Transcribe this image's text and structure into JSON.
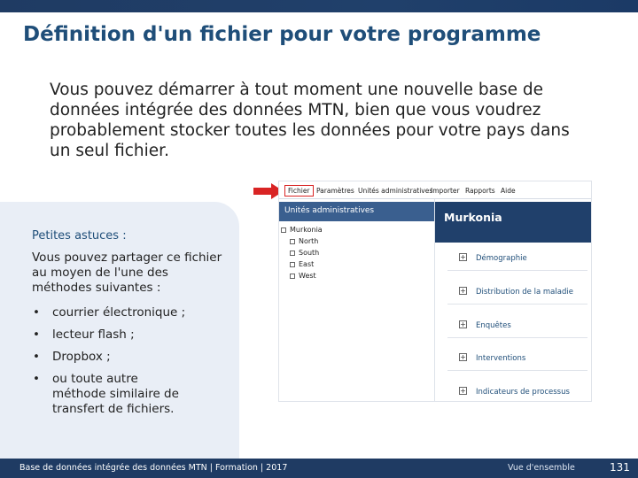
{
  "slide": {
    "title": "Définition d'un fichier pour votre programme",
    "intro": "Vous pouvez démarrer à tout moment une nouvelle base de données intégrée des données MTN, bien que vous voudrez probablement stocker toutes les données pour votre pays dans un seul fichier."
  },
  "tips": {
    "title": "Petites astuces :",
    "text": "Vous pouvez partager ce fichier au moyen de l'une des méthodes suivantes :",
    "items": [
      "courrier électronique ;",
      "lecteur flash ;",
      "Dropbox ;",
      "ou toute autre méthode similaire de transfert de fichiers."
    ]
  },
  "app": {
    "menu": [
      "Fichier",
      "Paramètres",
      "Unités administratives",
      "Importer",
      "Rapports",
      "Aide"
    ],
    "left_header": "Unités administratives",
    "tree": [
      {
        "label": "Murkonia",
        "level": 0,
        "marker": "minus"
      },
      {
        "label": "North",
        "level": 1,
        "marker": "plus"
      },
      {
        "label": "South",
        "level": 1,
        "marker": "plus"
      },
      {
        "label": "East",
        "level": 1,
        "marker": "empty"
      },
      {
        "label": "West",
        "level": 1,
        "marker": "plus"
      }
    ],
    "right_header": "Murkonia",
    "categories": [
      "Démographie",
      "Distribution de la maladie",
      "Enquêtes",
      "Interventions",
      "Indicateurs de processus"
    ]
  },
  "footer": {
    "text": "Base de données intégrée des données MTN | Formation | 2017",
    "link": "Vue d'ensemble",
    "page": "131"
  },
  "colors": {
    "title": "#1f4e79",
    "bar": "#1f3b63",
    "tip_bg": "#e9eef6",
    "highlight": "#d92424"
  }
}
